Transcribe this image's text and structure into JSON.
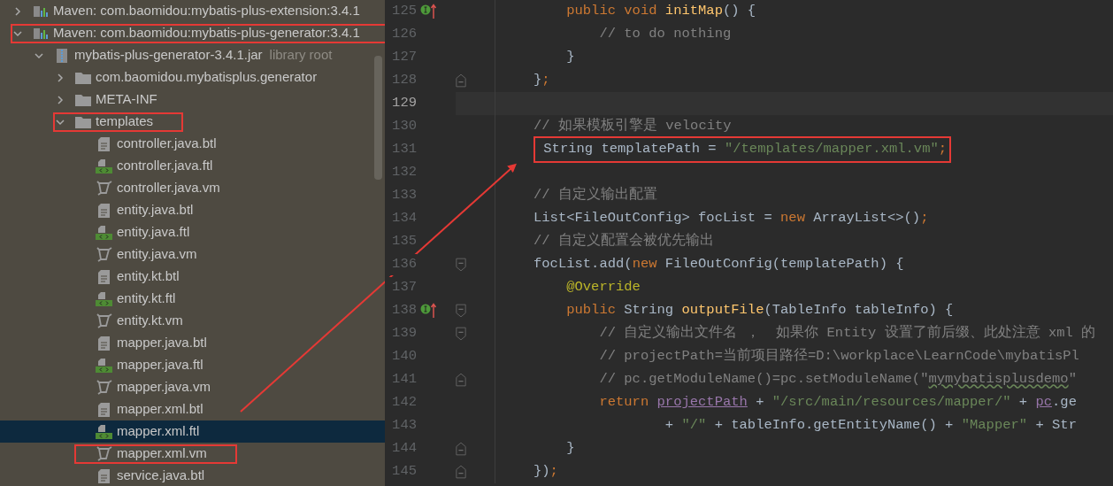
{
  "project_tree": {
    "items": [
      {
        "label": "Maven: com.baomidou:mybatis-plus-extension:3.4.1",
        "kind": "library",
        "expanded": false,
        "selected": false,
        "boxed": false
      },
      {
        "label": "Maven: com.baomidou:mybatis-plus-generator:3.4.1",
        "kind": "library",
        "expanded": true,
        "selected": false,
        "boxed": true,
        "children": [
          {
            "label": "mybatis-plus-generator-3.4.1.jar",
            "suffix": "library root",
            "kind": "jar",
            "expanded": true,
            "selected": false,
            "boxed": false,
            "children": [
              {
                "label": "com.baomidou.mybatisplus.generator",
                "kind": "folder",
                "expanded": false,
                "selected": false,
                "boxed": false
              },
              {
                "label": "META-INF",
                "kind": "folder",
                "expanded": false,
                "selected": false,
                "boxed": false
              },
              {
                "label": "templates",
                "kind": "folder",
                "expanded": true,
                "selected": false,
                "boxed": true,
                "children": [
                  {
                    "label": "controller.java.btl",
                    "kind": "btl",
                    "selected": false,
                    "boxed": false
                  },
                  {
                    "label": "controller.java.ftl",
                    "kind": "ftl",
                    "selected": false,
                    "boxed": false
                  },
                  {
                    "label": "controller.java.vm",
                    "kind": "vm",
                    "selected": false,
                    "boxed": false
                  },
                  {
                    "label": "entity.java.btl",
                    "kind": "btl",
                    "selected": false,
                    "boxed": false
                  },
                  {
                    "label": "entity.java.ftl",
                    "kind": "ftl",
                    "selected": false,
                    "boxed": false
                  },
                  {
                    "label": "entity.java.vm",
                    "kind": "vm",
                    "selected": false,
                    "boxed": false
                  },
                  {
                    "label": "entity.kt.btl",
                    "kind": "btl",
                    "selected": false,
                    "boxed": false
                  },
                  {
                    "label": "entity.kt.ftl",
                    "kind": "ftl",
                    "selected": false,
                    "boxed": false
                  },
                  {
                    "label": "entity.kt.vm",
                    "kind": "vm",
                    "selected": false,
                    "boxed": false
                  },
                  {
                    "label": "mapper.java.btl",
                    "kind": "btl",
                    "selected": false,
                    "boxed": false
                  },
                  {
                    "label": "mapper.java.ftl",
                    "kind": "ftl",
                    "selected": false,
                    "boxed": false
                  },
                  {
                    "label": "mapper.java.vm",
                    "kind": "vm",
                    "selected": false,
                    "boxed": false
                  },
                  {
                    "label": "mapper.xml.btl",
                    "kind": "btl",
                    "selected": false,
                    "boxed": false
                  },
                  {
                    "label": "mapper.xml.ftl",
                    "kind": "ftl",
                    "selected": true,
                    "boxed": false
                  },
                  {
                    "label": "mapper.xml.vm",
                    "kind": "vm",
                    "selected": false,
                    "boxed": true
                  },
                  {
                    "label": "service.java.btl",
                    "kind": "btl",
                    "selected": false,
                    "boxed": false
                  }
                ]
              }
            ]
          }
        ]
      }
    ]
  },
  "editor": {
    "lines": [
      {
        "number": "125",
        "current": false,
        "boxed": false,
        "marker": true,
        "tokens": [
          {
            "text": "    public",
            "kind": "keyword"
          },
          {
            "text": " void",
            "kind": "keyword"
          },
          {
            "text": " initMap",
            "kind": "function"
          },
          {
            "text": "() {",
            "kind": "plain"
          }
        ]
      },
      {
        "number": "126",
        "current": false,
        "boxed": false,
        "marker": false,
        "tokens": [
          {
            "text": "        // to do nothing",
            "kind": "comment"
          }
        ]
      },
      {
        "number": "127",
        "current": false,
        "boxed": false,
        "marker": false,
        "tokens": [
          {
            "text": "    }",
            "kind": "plain"
          }
        ]
      },
      {
        "number": "128",
        "current": false,
        "boxed": false,
        "marker": false,
        "fold_marker": {
          "kind": "end"
        },
        "tokens": [
          {
            "text": "}",
            "kind": "plain"
          },
          {
            "text": ";",
            "kind": "keyword"
          }
        ]
      },
      {
        "number": "129",
        "current": true,
        "marker": false
      },
      {
        "number": "130",
        "current": false,
        "boxed": false,
        "marker": false,
        "tokens": [
          {
            "text": "// 如果模板引擎是 velocity",
            "kind": "comment"
          }
        ]
      },
      {
        "number": "131",
        "current": false,
        "boxed": true,
        "marker": false,
        "tokens": [
          {
            "text": " String templatePath = ",
            "kind": "plain"
          },
          {
            "text": "\"/templates/mapper.xml.vm\"",
            "kind": "string"
          },
          {
            "text": ";",
            "kind": "keyword"
          }
        ]
      },
      {
        "number": "132",
        "current": false,
        "marker": false
      },
      {
        "number": "133",
        "current": false,
        "boxed": false,
        "marker": false,
        "tokens": [
          {
            "text": "// 自定义输出配置",
            "kind": "comment"
          }
        ]
      },
      {
        "number": "134",
        "current": false,
        "boxed": false,
        "marker": false,
        "tokens": [
          {
            "text": "List<FileOutConfig> focList = ",
            "kind": "plain"
          },
          {
            "text": "new",
            "kind": "keyword"
          },
          {
            "text": " ArrayList<>()",
            "kind": "plain"
          },
          {
            "text": ";",
            "kind": "keyword"
          }
        ]
      },
      {
        "number": "135",
        "current": false,
        "boxed": false,
        "marker": false,
        "tokens": [
          {
            "text": "// 自定义配置会被优先输出",
            "kind": "comment"
          }
        ]
      },
      {
        "number": "136",
        "current": false,
        "boxed": false,
        "marker": false,
        "fold_marker": {
          "kind": "start"
        },
        "tokens": [
          {
            "text": "focList.add(",
            "kind": "plain"
          },
          {
            "text": "new",
            "kind": "keyword"
          },
          {
            "text": " FileOutConfig(templatePath) {",
            "kind": "plain"
          }
        ]
      },
      {
        "number": "137",
        "current": false,
        "boxed": false,
        "marker": false,
        "tokens": [
          {
            "text": "    @Override",
            "kind": "annotation"
          }
        ]
      },
      {
        "number": "138",
        "current": false,
        "boxed": false,
        "marker": true,
        "fold_marker": {
          "kind": "start"
        },
        "tokens": [
          {
            "text": "    public",
            "kind": "keyword"
          },
          {
            "text": " String ",
            "kind": "plain"
          },
          {
            "text": "outputFile",
            "kind": "function"
          },
          {
            "text": "(TableInfo tableInfo) {",
            "kind": "plain"
          }
        ]
      },
      {
        "number": "139",
        "current": false,
        "boxed": false,
        "marker": false,
        "fold_marker": {
          "kind": "start"
        },
        "tokens": [
          {
            "text": "        // 自定义输出文件名 ，  如果你 Entity 设置了前后缀、此处注意 xml 的",
            "kind": "comment"
          }
        ]
      },
      {
        "number": "140",
        "current": false,
        "boxed": false,
        "marker": false,
        "tokens": [
          {
            "text": "        // projectPath=当前项目路径=D:\\workplace\\LearnCode\\mybatisPl",
            "kind": "comment"
          }
        ]
      },
      {
        "number": "141",
        "current": false,
        "boxed": false,
        "marker": false,
        "fold_marker": {
          "kind": "end"
        },
        "tokens": [
          {
            "text": "        // pc.getModuleName()=pc.setModuleName(\"",
            "kind": "comment"
          },
          {
            "text": "mymybatisplusdemo",
            "kind": "typo"
          },
          {
            "text": "\"",
            "kind": "comment"
          }
        ]
      },
      {
        "number": "142",
        "current": false,
        "boxed": false,
        "marker": false,
        "tokens": [
          {
            "text": "        return ",
            "kind": "keyword"
          },
          {
            "text": "projectPath",
            "kind": "field"
          },
          {
            "text": " + ",
            "kind": "plain"
          },
          {
            "text": "\"/src/main/resources/mapper/\"",
            "kind": "string"
          },
          {
            "text": " + ",
            "kind": "plain"
          },
          {
            "text": "pc",
            "kind": "field"
          },
          {
            "text": ".ge",
            "kind": "plain"
          }
        ]
      },
      {
        "number": "143",
        "current": false,
        "boxed": false,
        "marker": false,
        "tokens": [
          {
            "text": "                + ",
            "kind": "plain"
          },
          {
            "text": "\"/\"",
            "kind": "string"
          },
          {
            "text": " + tableInfo.getEntityName() + ",
            "kind": "plain"
          },
          {
            "text": "\"Mapper\"",
            "kind": "string"
          },
          {
            "text": " + Str",
            "kind": "plain"
          }
        ]
      },
      {
        "number": "144",
        "current": false,
        "boxed": false,
        "marker": false,
        "fold_marker": {
          "kind": "end"
        },
        "tokens": [
          {
            "text": "    }",
            "kind": "plain"
          }
        ]
      },
      {
        "number": "145",
        "current": false,
        "boxed": false,
        "marker": false,
        "fold_marker": {
          "kind": "end"
        },
        "tokens": [
          {
            "text": "})",
            "kind": "plain"
          },
          {
            "text": ";",
            "kind": "keyword"
          }
        ]
      }
    ]
  }
}
